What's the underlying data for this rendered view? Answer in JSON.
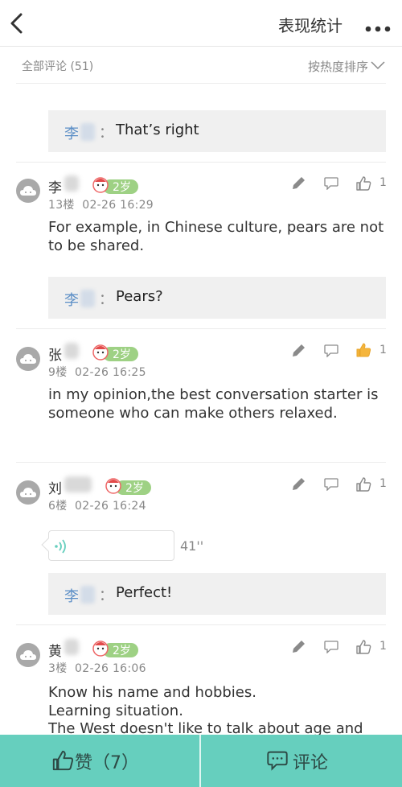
{
  "navbar": {
    "title": "表现统计"
  },
  "filter": {
    "all_comments": "全部评论 (51)",
    "sort": "按热度排序"
  },
  "replies": [
    {
      "name": "李",
      "colon": "：",
      "text": "That’s right"
    },
    {
      "name": "李",
      "colon": "：",
      "text": "Pears?"
    },
    {
      "name": "李",
      "colon": "：",
      "text": "Perfect!"
    }
  ],
  "comments": [
    {
      "name": "李",
      "level": "2岁",
      "floor": "13楼",
      "time": "02-26 16:29",
      "likes": "1",
      "liked": false,
      "text": "For example, in Chinese culture, pears are not to be shared."
    },
    {
      "name": "张",
      "level": "2岁",
      "floor": "9楼",
      "time": "02-26 16:25",
      "likes": "1",
      "liked": true,
      "text": "in my opinion,the best conversation starter is someone who can make others relaxed."
    },
    {
      "name": "刘",
      "level": "2岁",
      "floor": "6楼",
      "time": "02-26 16:24",
      "likes": "1",
      "liked": false,
      "voice_duration": "41''"
    },
    {
      "name": "黄",
      "level": "2岁",
      "floor": "3楼",
      "time": "02-26 16:06",
      "likes": "1",
      "liked": false,
      "text_lines": [
        "Know his name and hobbies.",
        "Learning situation.",
        "The West doesn't like to talk about age and"
      ]
    }
  ],
  "bottom_bar": {
    "like_label": "赞（7）",
    "comment_label": "评论"
  },
  "colors": {
    "accent": "#66cfbe",
    "like_active": "#f5b53c",
    "reply_name": "#5b8ec6",
    "level_badge": "#9ed184"
  },
  "icons": [
    "back-icon",
    "more-icon",
    "chevron-down-icon",
    "avatar-icon",
    "edit-icon",
    "chat-bubble-icon",
    "thumbs-up-icon",
    "voice-wave-icon",
    "comment-icon"
  ]
}
